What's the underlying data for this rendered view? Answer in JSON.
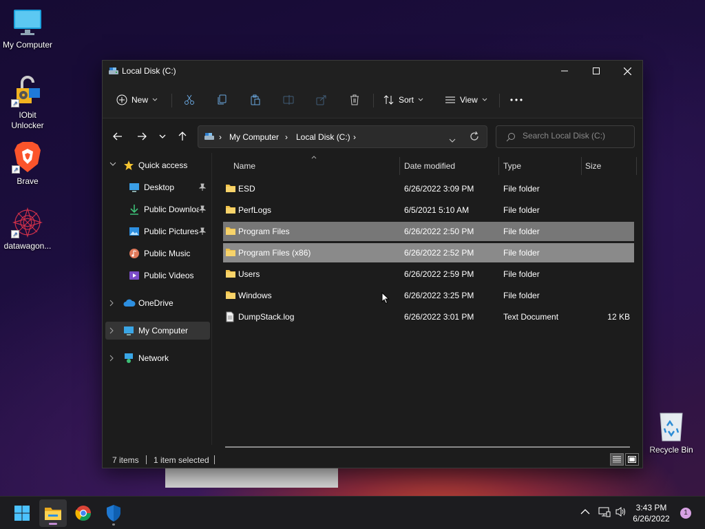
{
  "desktop": {
    "icons": [
      {
        "label": "My Computer"
      },
      {
        "label": "IObit Unlocker"
      },
      {
        "label": "Brave"
      },
      {
        "label": "datawagon..."
      },
      {
        "label": "Recycle Bin"
      }
    ]
  },
  "window": {
    "title": "Local Disk (C:)",
    "toolbar": {
      "new_label": "New",
      "sort_label": "Sort",
      "view_label": "View"
    },
    "address": {
      "crumbs": [
        "My Computer",
        "Local Disk (C:)"
      ],
      "search_placeholder": "Search Local Disk (C:)"
    },
    "sidebar": {
      "quick_access": "Quick access",
      "items": [
        {
          "label": "Desktop",
          "pinned": true
        },
        {
          "label": "Public Downloads",
          "pinned": true
        },
        {
          "label": "Public Pictures",
          "pinned": true
        },
        {
          "label": "Public Music",
          "pinned": false
        },
        {
          "label": "Public Videos",
          "pinned": false
        }
      ],
      "onedrive": "OneDrive",
      "my_computer": "My Computer",
      "network": "Network"
    },
    "columns": {
      "name": "Name",
      "date": "Date modified",
      "type": "Type",
      "size": "Size"
    },
    "files": [
      {
        "name": "ESD",
        "date": "6/26/2022 3:09 PM",
        "type": "File folder",
        "size": ""
      },
      {
        "name": "PerfLogs",
        "date": "6/5/2021 5:10 AM",
        "type": "File folder",
        "size": ""
      },
      {
        "name": "Program Files",
        "date": "6/26/2022 2:50 PM",
        "type": "File folder",
        "size": ""
      },
      {
        "name": "Program Files (x86)",
        "date": "6/26/2022 2:52 PM",
        "type": "File folder",
        "size": ""
      },
      {
        "name": "Users",
        "date": "6/26/2022 2:59 PM",
        "type": "File folder",
        "size": ""
      },
      {
        "name": "Windows",
        "date": "6/26/2022 3:25 PM",
        "type": "File folder",
        "size": ""
      },
      {
        "name": "DumpStack.log",
        "date": "6/26/2022 3:01 PM",
        "type": "Text Document",
        "size": "12 KB"
      }
    ],
    "status": {
      "count": "7 items",
      "selection": "1 item selected"
    }
  },
  "taskbar": {
    "time": "3:43 PM",
    "date": "6/26/2022",
    "notification_count": "1"
  },
  "colors": {
    "accent": "#60cdff",
    "folder": "#f0c24a",
    "selection": "#5f5f5f"
  }
}
